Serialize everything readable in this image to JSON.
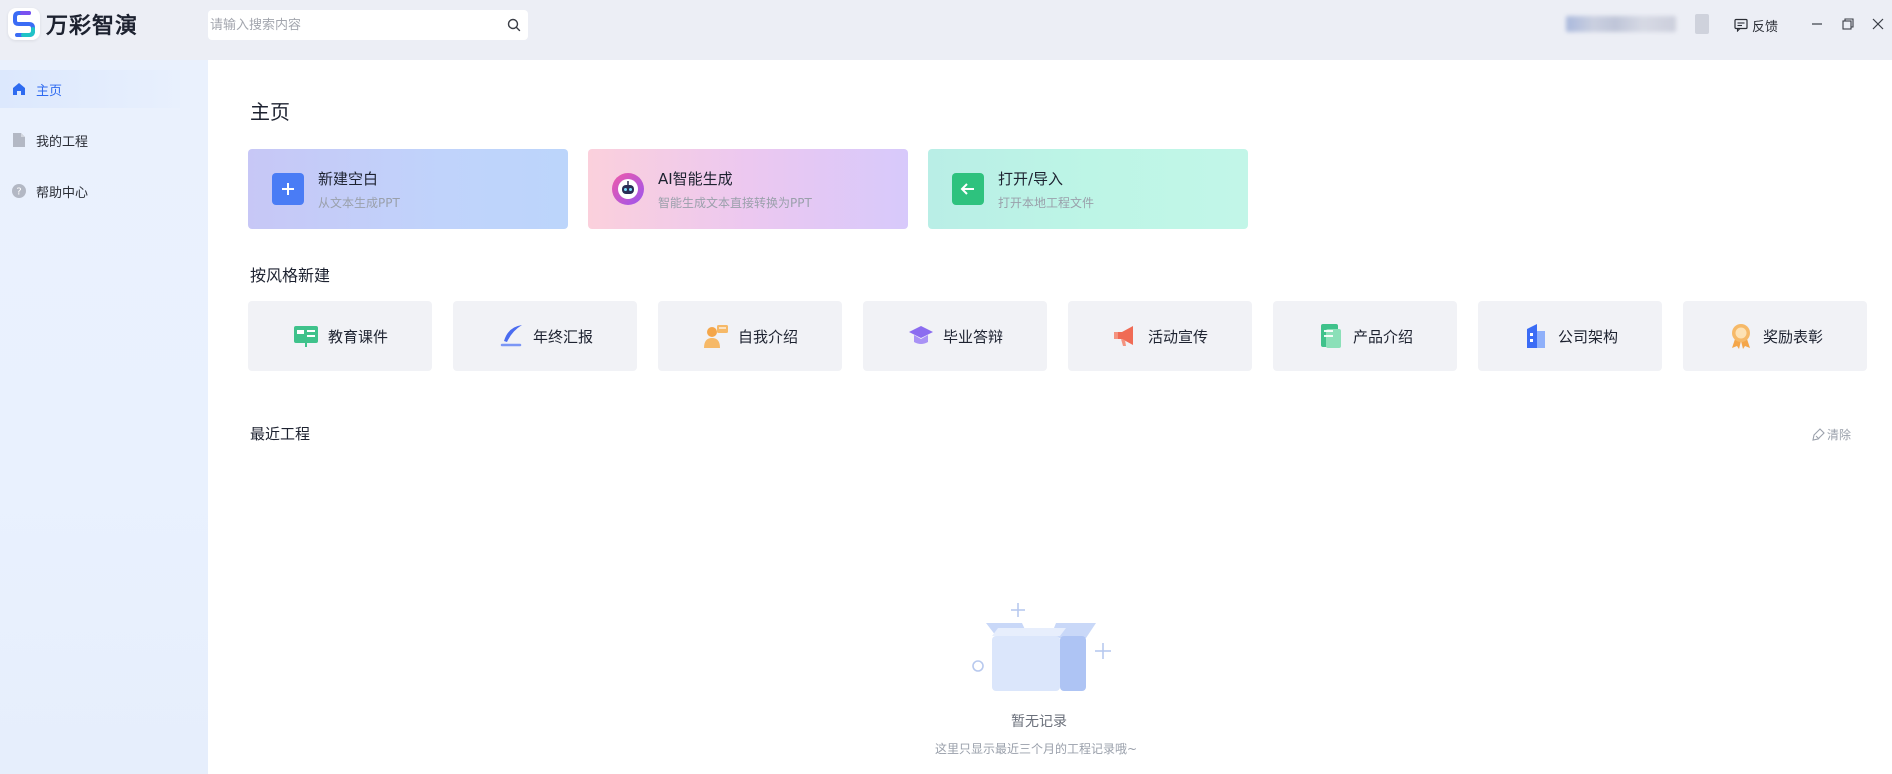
{
  "app": {
    "name": "万彩智演",
    "brand_color": "#2f6bf0"
  },
  "search": {
    "placeholder": "请输入搜索内容",
    "icon": "search-icon"
  },
  "header": {
    "feedback_label": "反馈",
    "window_controls": [
      "minimize-icon",
      "restore-icon",
      "close-icon"
    ]
  },
  "sidebar": {
    "items": [
      {
        "label": "主页",
        "icon": "home-icon",
        "active": true
      },
      {
        "label": "我的工程",
        "icon": "file-icon",
        "active": false
      },
      {
        "label": "帮助中心",
        "icon": "help-icon",
        "active": false
      }
    ]
  },
  "main": {
    "title": "主页",
    "quick_actions": [
      {
        "title": "新建空白",
        "subtitle": "从文本生成PPT",
        "icon": "plus-icon"
      },
      {
        "title": "AI智能生成",
        "subtitle": "智能生成文本直接转换为PPT",
        "icon": "robot-icon"
      },
      {
        "title": "打开/导入",
        "subtitle": "打开本地工程文件",
        "icon": "import-icon"
      }
    ],
    "style_section_title": "按风格新建",
    "styles": [
      {
        "label": "教育课件",
        "icon": "courseware-icon"
      },
      {
        "label": "年终汇报",
        "icon": "quill-icon"
      },
      {
        "label": "自我介绍",
        "icon": "person-icon"
      },
      {
        "label": "毕业答辩",
        "icon": "graduation-cap-icon"
      },
      {
        "label": "活动宣传",
        "icon": "megaphone-icon"
      },
      {
        "label": "产品介绍",
        "icon": "document-icon"
      },
      {
        "label": "公司架构",
        "icon": "building-icon"
      },
      {
        "label": "奖励表彰",
        "icon": "medal-icon"
      }
    ],
    "recent_section_title": "最近工程",
    "clear_label": "清除",
    "empty_title": "暂无记录",
    "empty_subtitle": "这里只显示最近三个月的工程记录哦~"
  }
}
